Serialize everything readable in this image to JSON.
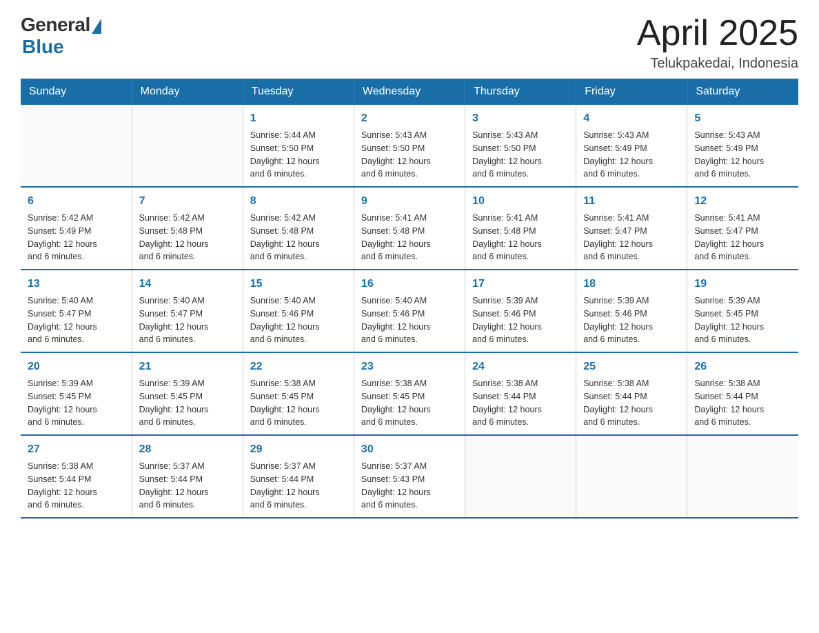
{
  "logo": {
    "general": "General",
    "blue": "Blue"
  },
  "title": "April 2025",
  "location": "Telukpakedai, Indonesia",
  "weekdays": [
    "Sunday",
    "Monday",
    "Tuesday",
    "Wednesday",
    "Thursday",
    "Friday",
    "Saturday"
  ],
  "weeks": [
    [
      {
        "day": "",
        "info": ""
      },
      {
        "day": "",
        "info": ""
      },
      {
        "day": "1",
        "info": "Sunrise: 5:44 AM\nSunset: 5:50 PM\nDaylight: 12 hours\nand 6 minutes."
      },
      {
        "day": "2",
        "info": "Sunrise: 5:43 AM\nSunset: 5:50 PM\nDaylight: 12 hours\nand 6 minutes."
      },
      {
        "day": "3",
        "info": "Sunrise: 5:43 AM\nSunset: 5:50 PM\nDaylight: 12 hours\nand 6 minutes."
      },
      {
        "day": "4",
        "info": "Sunrise: 5:43 AM\nSunset: 5:49 PM\nDaylight: 12 hours\nand 6 minutes."
      },
      {
        "day": "5",
        "info": "Sunrise: 5:43 AM\nSunset: 5:49 PM\nDaylight: 12 hours\nand 6 minutes."
      }
    ],
    [
      {
        "day": "6",
        "info": "Sunrise: 5:42 AM\nSunset: 5:49 PM\nDaylight: 12 hours\nand 6 minutes."
      },
      {
        "day": "7",
        "info": "Sunrise: 5:42 AM\nSunset: 5:48 PM\nDaylight: 12 hours\nand 6 minutes."
      },
      {
        "day": "8",
        "info": "Sunrise: 5:42 AM\nSunset: 5:48 PM\nDaylight: 12 hours\nand 6 minutes."
      },
      {
        "day": "9",
        "info": "Sunrise: 5:41 AM\nSunset: 5:48 PM\nDaylight: 12 hours\nand 6 minutes."
      },
      {
        "day": "10",
        "info": "Sunrise: 5:41 AM\nSunset: 5:48 PM\nDaylight: 12 hours\nand 6 minutes."
      },
      {
        "day": "11",
        "info": "Sunrise: 5:41 AM\nSunset: 5:47 PM\nDaylight: 12 hours\nand 6 minutes."
      },
      {
        "day": "12",
        "info": "Sunrise: 5:41 AM\nSunset: 5:47 PM\nDaylight: 12 hours\nand 6 minutes."
      }
    ],
    [
      {
        "day": "13",
        "info": "Sunrise: 5:40 AM\nSunset: 5:47 PM\nDaylight: 12 hours\nand 6 minutes."
      },
      {
        "day": "14",
        "info": "Sunrise: 5:40 AM\nSunset: 5:47 PM\nDaylight: 12 hours\nand 6 minutes."
      },
      {
        "day": "15",
        "info": "Sunrise: 5:40 AM\nSunset: 5:46 PM\nDaylight: 12 hours\nand 6 minutes."
      },
      {
        "day": "16",
        "info": "Sunrise: 5:40 AM\nSunset: 5:46 PM\nDaylight: 12 hours\nand 6 minutes."
      },
      {
        "day": "17",
        "info": "Sunrise: 5:39 AM\nSunset: 5:46 PM\nDaylight: 12 hours\nand 6 minutes."
      },
      {
        "day": "18",
        "info": "Sunrise: 5:39 AM\nSunset: 5:46 PM\nDaylight: 12 hours\nand 6 minutes."
      },
      {
        "day": "19",
        "info": "Sunrise: 5:39 AM\nSunset: 5:45 PM\nDaylight: 12 hours\nand 6 minutes."
      }
    ],
    [
      {
        "day": "20",
        "info": "Sunrise: 5:39 AM\nSunset: 5:45 PM\nDaylight: 12 hours\nand 6 minutes."
      },
      {
        "day": "21",
        "info": "Sunrise: 5:39 AM\nSunset: 5:45 PM\nDaylight: 12 hours\nand 6 minutes."
      },
      {
        "day": "22",
        "info": "Sunrise: 5:38 AM\nSunset: 5:45 PM\nDaylight: 12 hours\nand 6 minutes."
      },
      {
        "day": "23",
        "info": "Sunrise: 5:38 AM\nSunset: 5:45 PM\nDaylight: 12 hours\nand 6 minutes."
      },
      {
        "day": "24",
        "info": "Sunrise: 5:38 AM\nSunset: 5:44 PM\nDaylight: 12 hours\nand 6 minutes."
      },
      {
        "day": "25",
        "info": "Sunrise: 5:38 AM\nSunset: 5:44 PM\nDaylight: 12 hours\nand 6 minutes."
      },
      {
        "day": "26",
        "info": "Sunrise: 5:38 AM\nSunset: 5:44 PM\nDaylight: 12 hours\nand 6 minutes."
      }
    ],
    [
      {
        "day": "27",
        "info": "Sunrise: 5:38 AM\nSunset: 5:44 PM\nDaylight: 12 hours\nand 6 minutes."
      },
      {
        "day": "28",
        "info": "Sunrise: 5:37 AM\nSunset: 5:44 PM\nDaylight: 12 hours\nand 6 minutes."
      },
      {
        "day": "29",
        "info": "Sunrise: 5:37 AM\nSunset: 5:44 PM\nDaylight: 12 hours\nand 6 minutes."
      },
      {
        "day": "30",
        "info": "Sunrise: 5:37 AM\nSunset: 5:43 PM\nDaylight: 12 hours\nand 6 minutes."
      },
      {
        "day": "",
        "info": ""
      },
      {
        "day": "",
        "info": ""
      },
      {
        "day": "",
        "info": ""
      }
    ]
  ]
}
